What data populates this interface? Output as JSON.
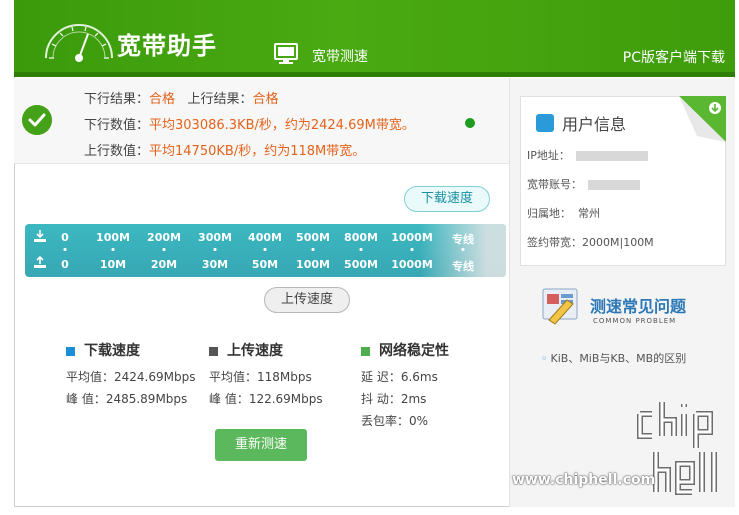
{
  "header": {
    "title": "宽带助手",
    "nav_speedtest": "宽带测速",
    "nav_pc": "PC版客户端下载"
  },
  "result": {
    "download_result_label": "下行结果：",
    "download_result_value": "合格",
    "upload_result_label": "上行结果：",
    "upload_result_value": "合格",
    "download_value_label": "下行数值：",
    "download_value_text": "平均303086.3KB/秒，约为2424.69M带宽。",
    "upload_value_label": "上行数值：",
    "upload_value_text": "平均14750KB/秒，约为118M带宽。"
  },
  "scale": {
    "download_bubble": "下载速度",
    "upload_bubble": "上传速度",
    "download_ticks": [
      "0",
      "100M",
      "200M",
      "300M",
      "400M",
      "500M",
      "800M",
      "1000M",
      "专线"
    ],
    "upload_ticks": [
      "0",
      "10M",
      "20M",
      "30M",
      "50M",
      "100M",
      "500M",
      "1000M",
      "专线"
    ]
  },
  "stats": {
    "download": {
      "title": "下载速度",
      "avg": "平均值：2424.69Mbps",
      "peak": "峰 值：2485.89Mbps",
      "color": "#1a8fd6"
    },
    "upload": {
      "title": "上传速度",
      "avg": "平均值：118Mbps",
      "peak": "峰 值：122.69Mbps",
      "color": "#555555"
    },
    "network": {
      "title": "网络稳定性",
      "latency": "延 迟：6.6ms",
      "jitter": "抖 动：2ms",
      "loss": "丢包率：0%",
      "color": "#4cae4c"
    }
  },
  "retest_label": "重新测速",
  "user_info": {
    "title": "用户信息",
    "ip_label": "IP地址：",
    "account_label": "宽带账号：",
    "location_label": "归属地：",
    "location_value": "常州",
    "bandwidth_label": "签约带宽：",
    "bandwidth_value": "2000M|100M"
  },
  "faq": {
    "title": "测速常见问题",
    "subtitle": "COMMON PROBLEM",
    "link": "KiB、MiB与KB、MB的区别"
  },
  "watermark": {
    "url": "www.chiphell.com",
    "logo_text": "chip hell"
  },
  "colors": {
    "header_green": "#3f9c0b",
    "accent_orange": "#e3631c",
    "scale_teal": "#3cb8c1",
    "button_green": "#5cb85c"
  }
}
